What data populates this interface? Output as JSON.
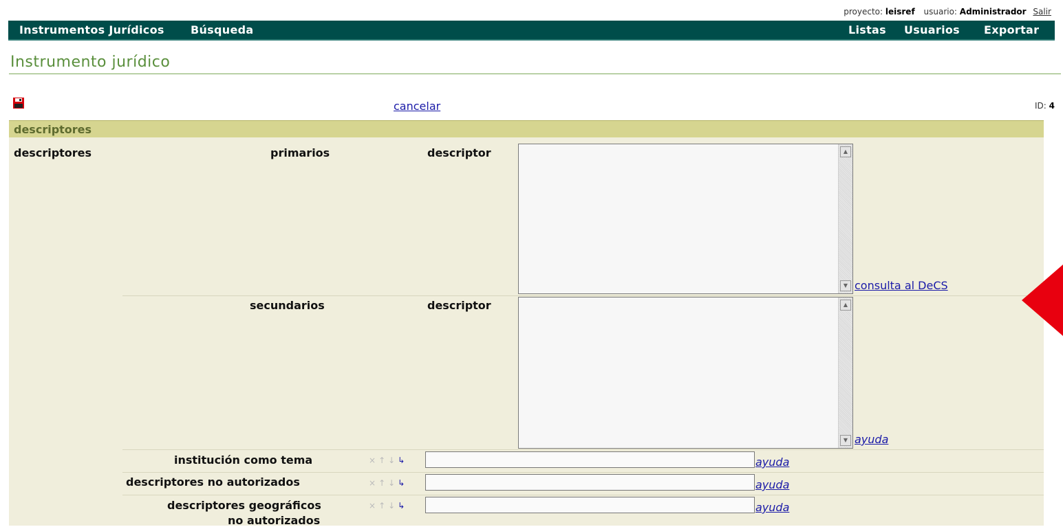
{
  "topbar": {
    "project_label": "proyecto:",
    "project_value": "leisref",
    "user_label": "usuario:",
    "user_value": "Administrador",
    "logout": "Salir"
  },
  "nav": {
    "left": [
      "Instrumentos Jurídicos",
      "Búsqueda"
    ],
    "right": [
      "Listas",
      "Usuarios",
      "Exportar"
    ]
  },
  "page": {
    "title": "Instrumento jurídico",
    "cancel": "cancelar",
    "id_label": "ID:",
    "id_value": "4"
  },
  "section": {
    "header": "descriptores",
    "group_label": "descriptores",
    "primary_label": "primarios",
    "secondary_label": "secundarios",
    "descriptor_label": "descriptor",
    "decs_link": "consulta al DeCS",
    "help_link": "ayuda"
  },
  "fields": [
    {
      "label": "institución como tema",
      "help": "ayuda"
    },
    {
      "label": "descriptores no autorizados",
      "help": "ayuda"
    },
    {
      "label": "descriptores geográficos",
      "label2": "no autorizados",
      "help": "ayuda"
    }
  ],
  "controls": {
    "remove": "×",
    "up": "↑",
    "down": "↓",
    "add": "↳"
  },
  "colors": {
    "navbar": "#004d4a",
    "title": "#5a8f3c",
    "section_header": "#d6d590",
    "panel": "#f0eedc",
    "link": "#1a1aa8",
    "annotation_arrow": "#e8000f"
  }
}
